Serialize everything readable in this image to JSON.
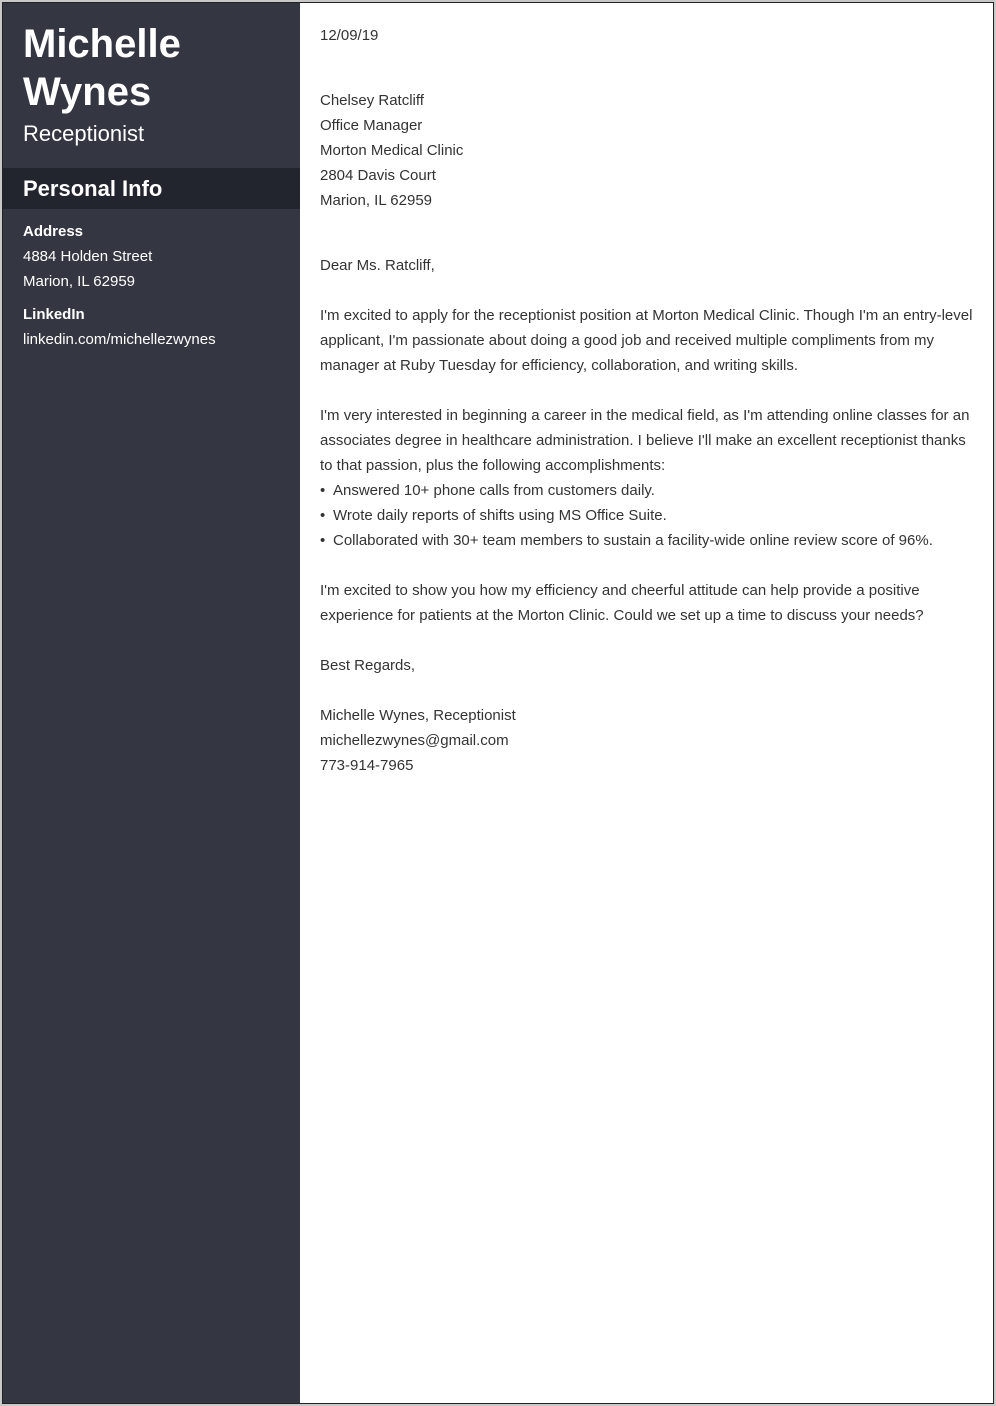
{
  "sidebar": {
    "name_first": "Michelle",
    "name_last": "Wynes",
    "job_title": "Receptionist",
    "section_title": "Personal Info",
    "address": {
      "label": "Address",
      "lines": [
        "4884 Holden Street",
        "Marion, IL 62959"
      ]
    },
    "linkedin": {
      "label": "LinkedIn",
      "value": "linkedin.com/michellezwynes"
    },
    "colors": {
      "sidebar_bg": "#343741",
      "section_bar_bg": "#22252d"
    }
  },
  "letter": {
    "date": "12/09/19",
    "recipient": [
      "Chelsey Ratcliff",
      "Office Manager",
      "Morton Medical Clinic",
      "2804 Davis Court",
      "Marion, IL 62959"
    ],
    "salutation": "Dear Ms. Ratcliff,",
    "paragraph1": "I'm excited to apply for the receptionist position at Morton Medical Clinic. Though I'm an entry-level applicant, I'm passionate about doing a good job and received multiple compliments from my manager at Ruby Tuesday for efficiency, collaboration, and writing skills.",
    "paragraph2": "I'm very interested in beginning a career in the medical field, as I'm attending online classes for an associates degree in healthcare administration. I believe I'll make an excellent receptionist thanks to that passion, plus the following accomplishments:",
    "bullet_glyph": "•",
    "bullets": [
      "Answered 10+ phone calls from customers daily.",
      "Wrote daily reports of shifts using MS Office Suite.",
      "Collaborated with 30+ team members to sustain a facility-wide online review score of 96%."
    ],
    "paragraph3": "I'm excited to show you how my efficiency and cheerful attitude can help provide a positive experience for patients at the Morton Clinic. Could we set up a time to discuss your needs?",
    "closing": "Best Regards,",
    "signature": {
      "name_title": "Michelle Wynes, Receptionist",
      "email": "michellezwynes@gmail.com",
      "phone": "773-914-7965"
    }
  }
}
